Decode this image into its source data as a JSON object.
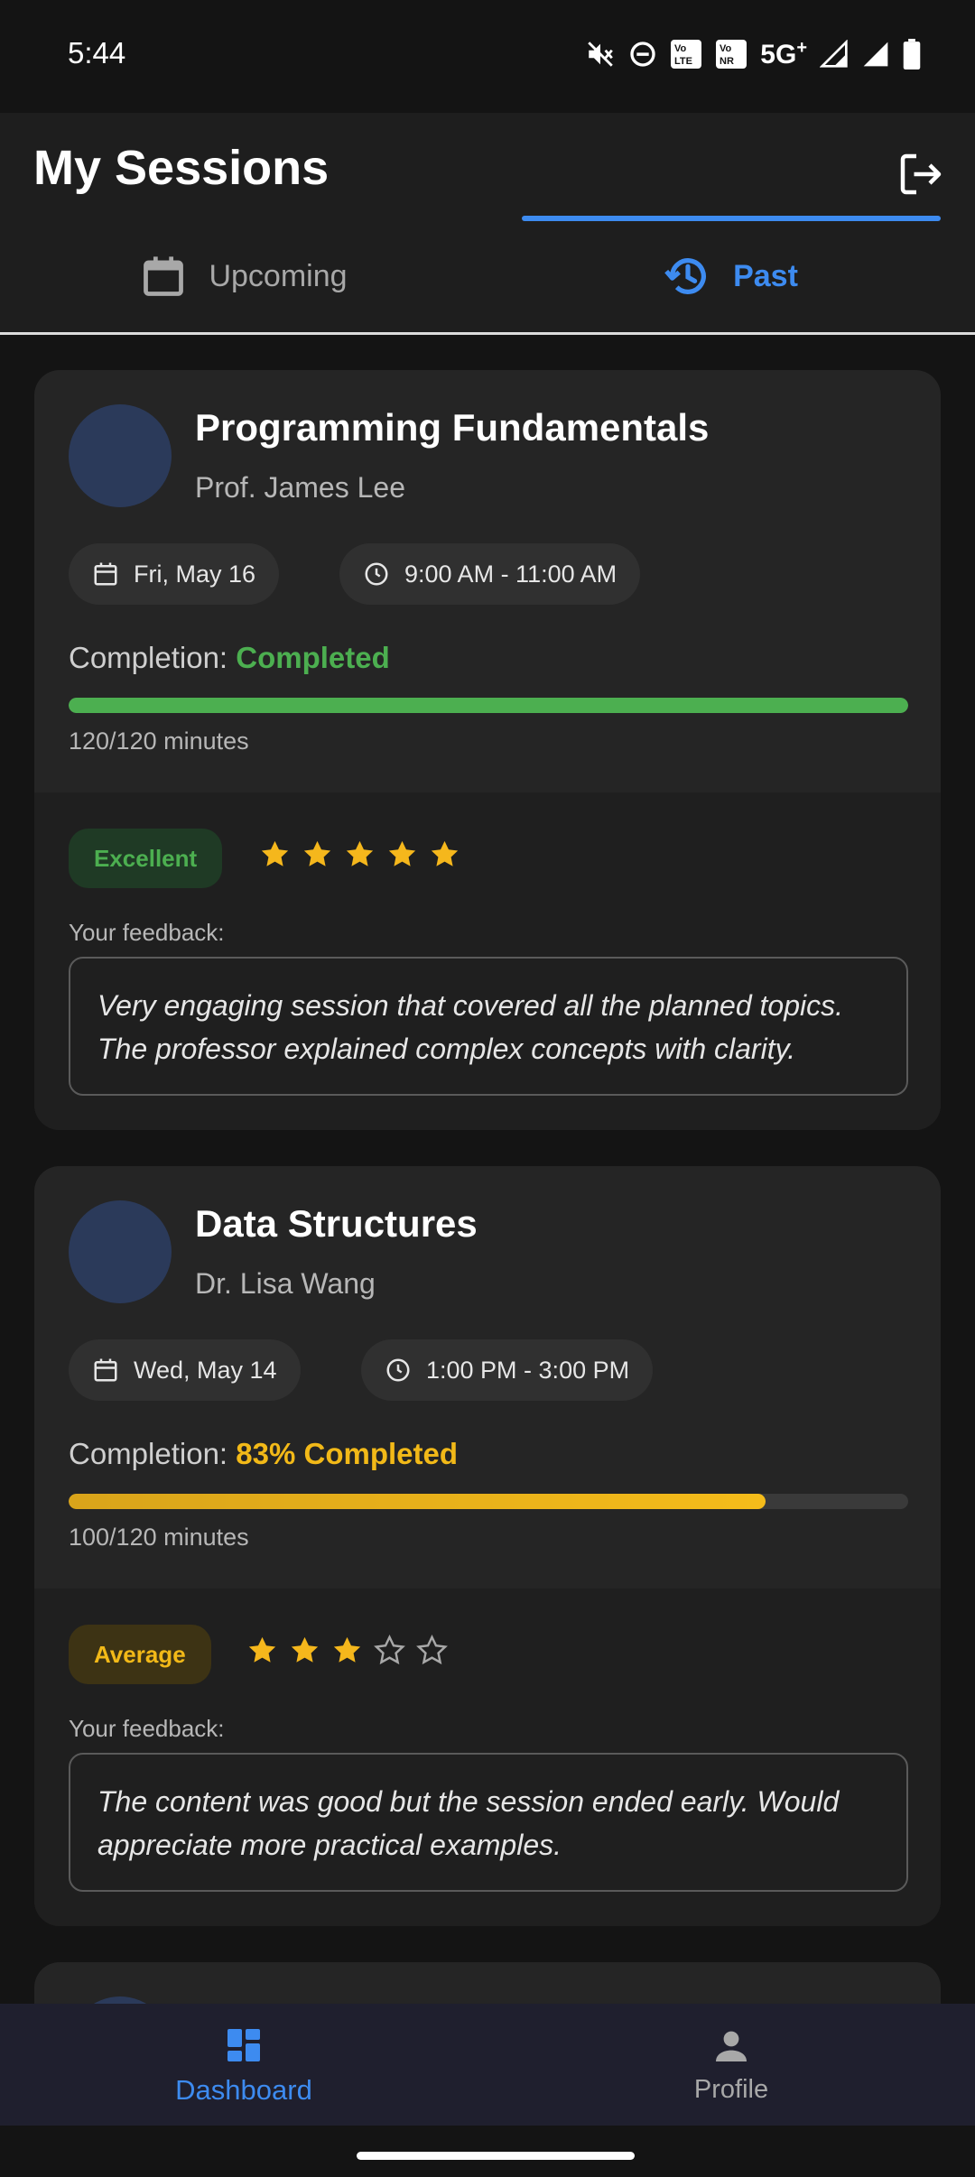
{
  "status": {
    "time": "5:44",
    "network": "5G",
    "network_plus": "+",
    "lte1": [
      "Vo",
      "LTE"
    ],
    "lte2": [
      "Vo",
      "NR"
    ]
  },
  "header": {
    "title": "My Sessions"
  },
  "tabs": [
    {
      "label": "Upcoming",
      "icon": "calendar-icon",
      "selected": false
    },
    {
      "label": "Past",
      "icon": "history-icon",
      "selected": true
    }
  ],
  "sessions": [
    {
      "title": "Programming Fundamentals",
      "instructor": "Prof. James Lee",
      "date": "Fri, May 16",
      "time": "9:00 AM - 11:00 AM",
      "completion_label": "Completion:",
      "completion_status": "Completed",
      "progress": 1.0,
      "minutes": "120/120 minutes",
      "rating_label": "Excellent",
      "rating": 5,
      "feedback_label": "Your feedback:",
      "feedback": "Very engaging session that covered all the planned topics. The professor explained complex concepts with clarity.",
      "accent": "#4caf50"
    },
    {
      "title": "Data Structures",
      "instructor": "Dr. Lisa Wang",
      "date": "Wed, May 14",
      "time": "1:00 PM - 3:00 PM",
      "completion_label": "Completion:",
      "completion_status": "83% Completed",
      "progress": 0.83,
      "minutes": "100/120 minutes",
      "rating_label": "Average",
      "rating": 3,
      "feedback_label": "Your feedback:",
      "feedback": "The content was good but the session ended early. Would appreciate more practical examples.",
      "accent": "#f2b918"
    }
  ],
  "nav": [
    {
      "label": "Dashboard",
      "icon": "dashboard-icon",
      "active": true
    },
    {
      "label": "Profile",
      "icon": "person-icon",
      "active": false
    }
  ],
  "colors": {
    "primary": "#3d8bf0",
    "star": "#f5b71c",
    "background": "#141414",
    "card": "#252525"
  }
}
